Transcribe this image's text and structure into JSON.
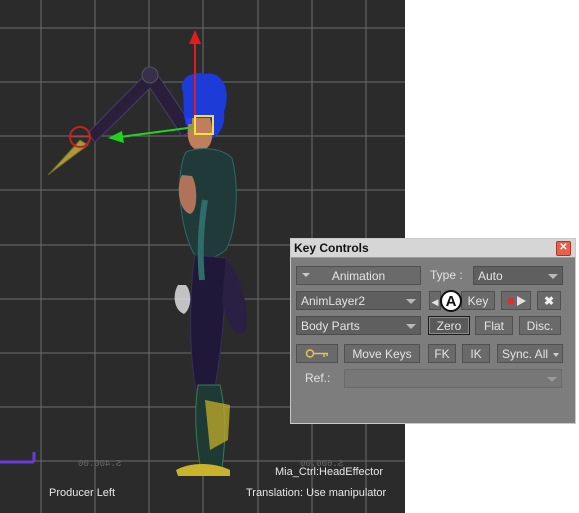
{
  "viewport": {
    "view_name": "Producer Left",
    "selected_object": "Mia_Ctrl:HeadEffector",
    "status": "Translation: Use manipulator",
    "dim_left": "S.400.00",
    "dim_right": "S.600.00"
  },
  "panel": {
    "title": "Key Controls",
    "close_icon": "close-icon",
    "row1": {
      "animation_label": "Animation",
      "type_label": "Type :",
      "type_value": "Auto"
    },
    "row2": {
      "layer_value": "AnimLayer2",
      "key_label": "Key"
    },
    "row3": {
      "body_parts_value": "Body Parts",
      "zero_label": "Zero",
      "flat_label": "Flat",
      "disc_label": "Disc."
    },
    "row4": {
      "move_keys_label": "Move Keys",
      "fk_label": "FK",
      "ik_label": "IK",
      "sync_label": "Sync. All"
    },
    "row5": {
      "ref_label": "Ref.:",
      "ref_value": ""
    }
  },
  "callout": {
    "label": "A"
  },
  "colors": {
    "viewport_bg": "#2b2b2b",
    "grid": "#8a8a8a",
    "axis_x": "#1fd31f",
    "axis_y": "#e01d1d",
    "panel_bg": "#7d7d7d",
    "record_dot": "#d93030"
  }
}
